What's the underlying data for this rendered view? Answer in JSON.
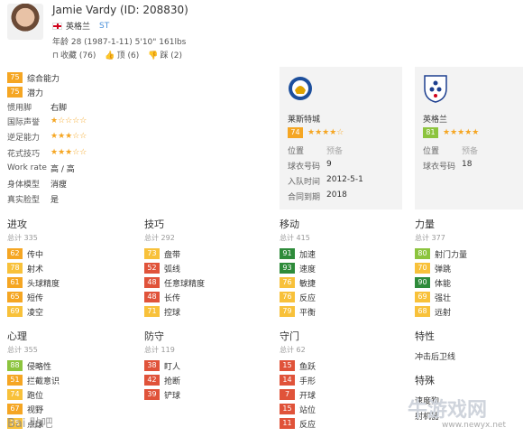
{
  "player": {
    "name": "Jamie Vardy (ID: 208830)",
    "nationality": "英格兰",
    "position": "ST",
    "info": "年龄 28 (1987-1-11) 5'10\" 161lbs",
    "actions": [
      {
        "label": "收藏 (76)",
        "icon": "bookmark-icon"
      },
      {
        "label": "顶 (6)",
        "icon": "thumbs-up-icon"
      },
      {
        "label": "踩 (2)",
        "icon": "thumbs-down-icon"
      }
    ]
  },
  "attributes": {
    "overall": {
      "value": "75",
      "label": "综合能力"
    },
    "potential": {
      "value": "75",
      "label": "潜力"
    },
    "foot": {
      "label": "惯用脚",
      "value": "右脚"
    },
    "reputation": {
      "label": "国际声誉",
      "stars": "★☆☆☆☆"
    },
    "weak_foot": {
      "label": "逆足能力",
      "stars": "★★★☆☆"
    },
    "skill_moves": {
      "label": "花式技巧",
      "stars": "★★★☆☆"
    },
    "work_rate": {
      "label": "Work rate",
      "value": "高 / 高"
    },
    "body_type": {
      "label": "身体模型",
      "value": "消瘦"
    },
    "real_face": {
      "label": "真实脸型",
      "value": "是"
    }
  },
  "club": {
    "name": "莱斯特城",
    "rating": "74",
    "stars": "★★★★☆",
    "rows": [
      {
        "k": "位置",
        "v": "预备"
      },
      {
        "k": "球衣号码",
        "v": "9"
      },
      {
        "k": "入队时间",
        "v": "2012-5-1"
      },
      {
        "k": "合同到期",
        "v": "2018"
      }
    ]
  },
  "national": {
    "name": "英格兰",
    "rating": "81",
    "stars": "★★★★★",
    "rows": [
      {
        "k": "位置",
        "v": "预备"
      },
      {
        "k": "球衣号码",
        "v": "18"
      }
    ]
  },
  "sections": {
    "attack": {
      "title": "进攻",
      "total": "总计 335",
      "items": [
        {
          "v": "62",
          "n": "传中"
        },
        {
          "v": "78",
          "n": "射术"
        },
        {
          "v": "61",
          "n": "头球精度"
        },
        {
          "v": "65",
          "n": "短传"
        },
        {
          "v": "69",
          "n": "凌空"
        }
      ]
    },
    "skill": {
      "title": "技巧",
      "total": "总计 292",
      "items": [
        {
          "v": "73",
          "n": "盘带"
        },
        {
          "v": "52",
          "n": "弧线"
        },
        {
          "v": "48",
          "n": "任意球精度"
        },
        {
          "v": "48",
          "n": "长传"
        },
        {
          "v": "71",
          "n": "控球"
        }
      ]
    },
    "movement": {
      "title": "移动",
      "total": "总计 415",
      "items": [
        {
          "v": "91",
          "n": "加速"
        },
        {
          "v": "93",
          "n": "速度"
        },
        {
          "v": "76",
          "n": "敏捷"
        },
        {
          "v": "76",
          "n": "反应"
        },
        {
          "v": "79",
          "n": "平衡"
        }
      ]
    },
    "power": {
      "title": "力量",
      "total": "总计 377",
      "items": [
        {
          "v": "80",
          "n": "射门力量"
        },
        {
          "v": "70",
          "n": "弹跳"
        },
        {
          "v": "90",
          "n": "体能"
        },
        {
          "v": "69",
          "n": "强壮"
        },
        {
          "v": "68",
          "n": "远射"
        }
      ]
    },
    "mentality": {
      "title": "心理",
      "total": "总计 355",
      "items": [
        {
          "v": "88",
          "n": "侵略性"
        },
        {
          "v": "51",
          "n": "拦截意识"
        },
        {
          "v": "74",
          "n": "跑位"
        },
        {
          "v": "67",
          "n": "视野"
        },
        {
          "v": "75",
          "n": "点球"
        }
      ]
    },
    "defending": {
      "title": "防守",
      "total": "总计 119",
      "items": [
        {
          "v": "38",
          "n": "盯人"
        },
        {
          "v": "42",
          "n": "抢断"
        },
        {
          "v": "39",
          "n": "铲球"
        }
      ]
    },
    "goalkeeping": {
      "title": "守门",
      "total": "总计 62",
      "items": [
        {
          "v": "15",
          "n": "鱼跃"
        },
        {
          "v": "14",
          "n": "手形"
        },
        {
          "v": "7",
          "n": "开球"
        },
        {
          "v": "15",
          "n": "站位"
        },
        {
          "v": "11",
          "n": "反应"
        }
      ]
    },
    "traits": {
      "title": "特性",
      "value": "冲击后卫线"
    },
    "specialties": {
      "title": "特殊",
      "value": "速度狗",
      "value2": "射机器"
    }
  },
  "watermark": {
    "left": "Bai 贴吧",
    "right": "牛游戏网",
    "url": "www.newyx.net"
  }
}
